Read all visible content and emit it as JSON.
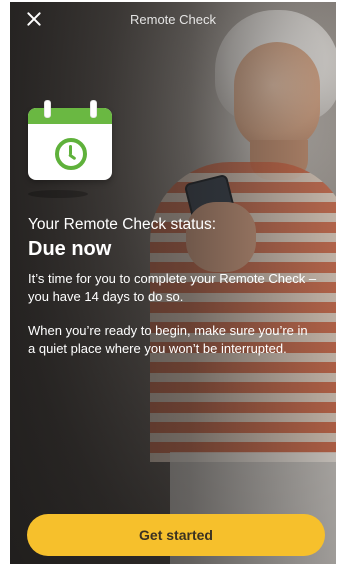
{
  "header": {
    "title": "Remote Check"
  },
  "status": {
    "label": "Your Remote Check status:",
    "value": "Due now"
  },
  "body": {
    "paragraph1": "It’s time for you to complete your Remote Check – you have 14 days to do so.",
    "paragraph2": "When you’re ready to begin, make sure you’re in a quiet place where you won’t be interrupted."
  },
  "actions": {
    "primary_label": "Get started"
  },
  "colors": {
    "accent": "#f6c02c",
    "calendar_green": "#6ab842"
  },
  "icons": {
    "close": "close-icon",
    "calendar": "calendar-clock-icon"
  }
}
